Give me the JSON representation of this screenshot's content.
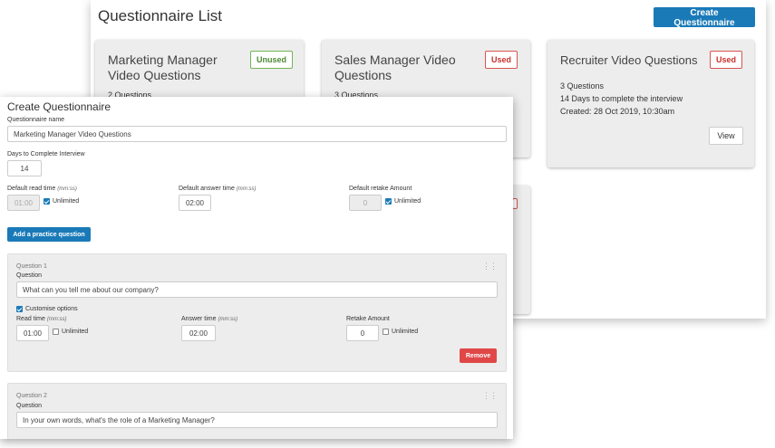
{
  "list": {
    "title": "Questionnaire List",
    "create_button": "Create Questionnaire",
    "cards": [
      {
        "title": "Marketing Manager Video Questions",
        "status": "Unused",
        "questions": "2 Questions"
      },
      {
        "title": "Sales Manager Video Questions",
        "status": "Used",
        "questions": "3 Questions"
      },
      {
        "title": "Recruiter Video Questions",
        "status": "Used",
        "questions": "3 Questions",
        "days": "14 Days to complete the interview",
        "created": "Created: 28 Oct 2019, 10:30am",
        "view": "View"
      }
    ]
  },
  "form": {
    "title": "Create Questionnaire",
    "name_label": "Questionnaire name",
    "name_value": "Marketing Manager Video Questions",
    "days_label": "Days to Complete Interview",
    "days_value": "14",
    "read_label": "Default read time",
    "answer_label": "Default answer time",
    "time_hint": "(mm:ss)",
    "retake_label": "Default retake Amount",
    "read_value": "01:00",
    "answer_value": "02:00",
    "retake_value": "0",
    "unlimited": "Unlimited",
    "practice_button": "Add a practice question",
    "questions": [
      {
        "number": "Question 1",
        "label": "Question",
        "text": "What can you tell me about our company?",
        "customise": "Customise options",
        "read_label": "Read time",
        "answer_label": "Answer time",
        "retake_label": "Retake Amount",
        "read_value": "01:00",
        "answer_value": "02:00",
        "retake_value": "0",
        "remove": "Remove"
      },
      {
        "number": "Question 2",
        "label": "Question",
        "text": "In your own words, what's the role of a Marketing Manager?"
      }
    ]
  },
  "icons": {
    "drag": "drag-handle-icon",
    "check": "checkbox-icon"
  },
  "colors": {
    "primary": "#1a7ab8",
    "danger": "#e04848",
    "unused": "#4a8a34",
    "used": "#c9302c"
  }
}
